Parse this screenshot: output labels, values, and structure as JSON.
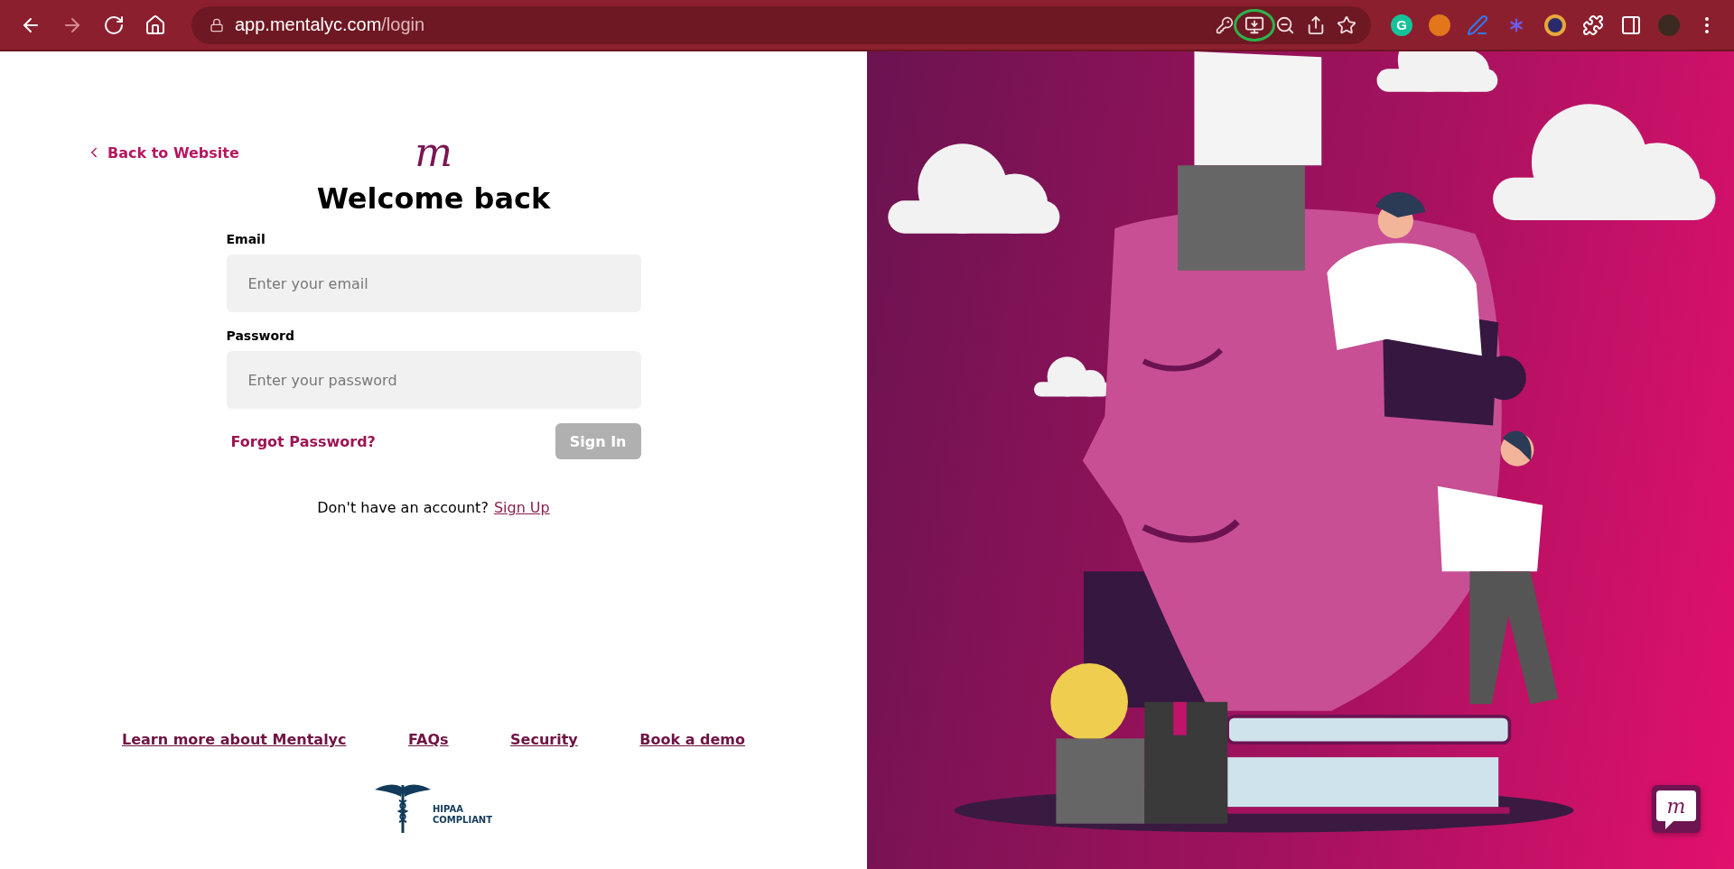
{
  "browser": {
    "nav": [
      {
        "kind": "back",
        "disabled": false
      },
      {
        "kind": "forward",
        "disabled": true
      },
      {
        "kind": "reload",
        "disabled": false
      },
      {
        "kind": "home",
        "disabled": false
      }
    ],
    "url_domain": "app.mentalyc.com",
    "url_path": "/login",
    "extension_badge": "G"
  },
  "back_link": "Back to Website",
  "logo": "m",
  "title": "Welcome back",
  "fields": [
    {
      "label": "Email",
      "placeholder": "Enter your email"
    },
    {
      "label": "Password",
      "placeholder": "Enter your password"
    }
  ],
  "forgot_link": "Forgot Password?",
  "sign_in": {
    "label": "Sign In",
    "disabled": true
  },
  "signup_prompt": "Don't have an account?",
  "signup_link": "Sign Up",
  "footer_links": [
    "Learn more about Mentalyc",
    "FAQs",
    "Security",
    "Book a demo"
  ],
  "hipaa": [
    "HIPAA",
    "COMPLIANT"
  ],
  "chat_logo": "m"
}
